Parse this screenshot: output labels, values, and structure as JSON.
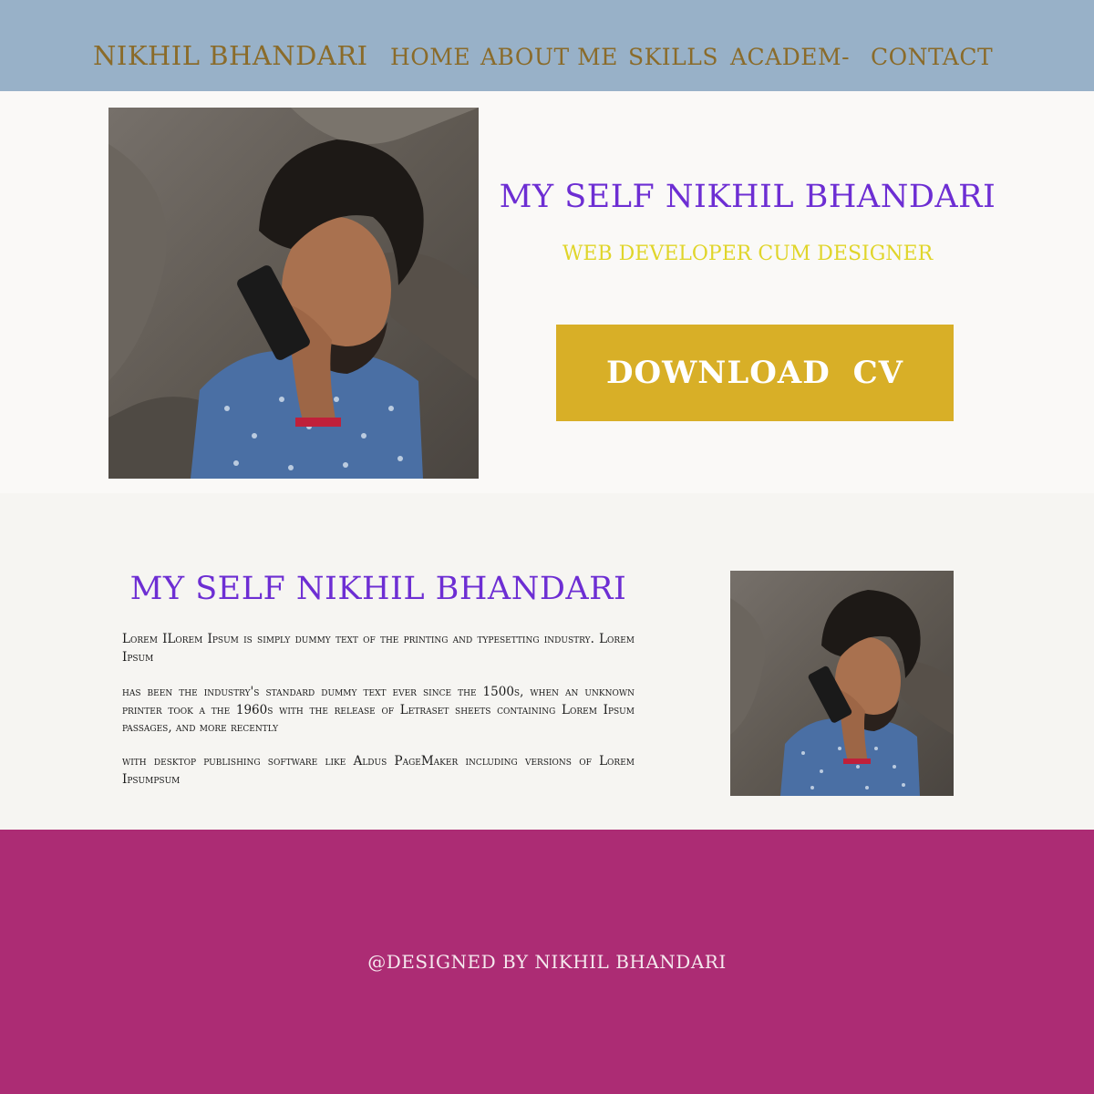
{
  "nav": {
    "brand": "NIKHIL BHANDARI",
    "links": [
      "HOME",
      "ABOUT ME",
      "SKILLS",
      "ACADEM-",
      "CONTACT"
    ]
  },
  "hero": {
    "title": "MY SELF NIKHIL BHANDARI",
    "subtitle": "WEB DEVELOPER CUM DESIGNER",
    "download_label": "DOWNLOAD CV"
  },
  "about": {
    "title": "MY SELF NIKHIL BHANDARI",
    "paragraphs": [
      "Lorem ILorem Ipsum is simply dummy text of the printing and typesetting industry. Lorem Ipsum",
      "has been the industry's standard dummy text ever since the 1500s, when an unknown printer took a the 1960s with the release of Letraset sheets containing Lorem Ipsum passages, and more recently",
      "with desktop publishing software like Aldus PageMaker including versions of Lorem Ipsumpsum"
    ]
  },
  "footer": {
    "text": "@DESIGNED BY NIKHIL BHANDARI"
  },
  "colors": {
    "nav_bg": "#98b1c8",
    "nav_text": "#8a6b2a",
    "title": "#6d2ed3",
    "subtitle": "#e0d52a",
    "button": "#d8af27",
    "footer_bg": "#ac2c74"
  }
}
